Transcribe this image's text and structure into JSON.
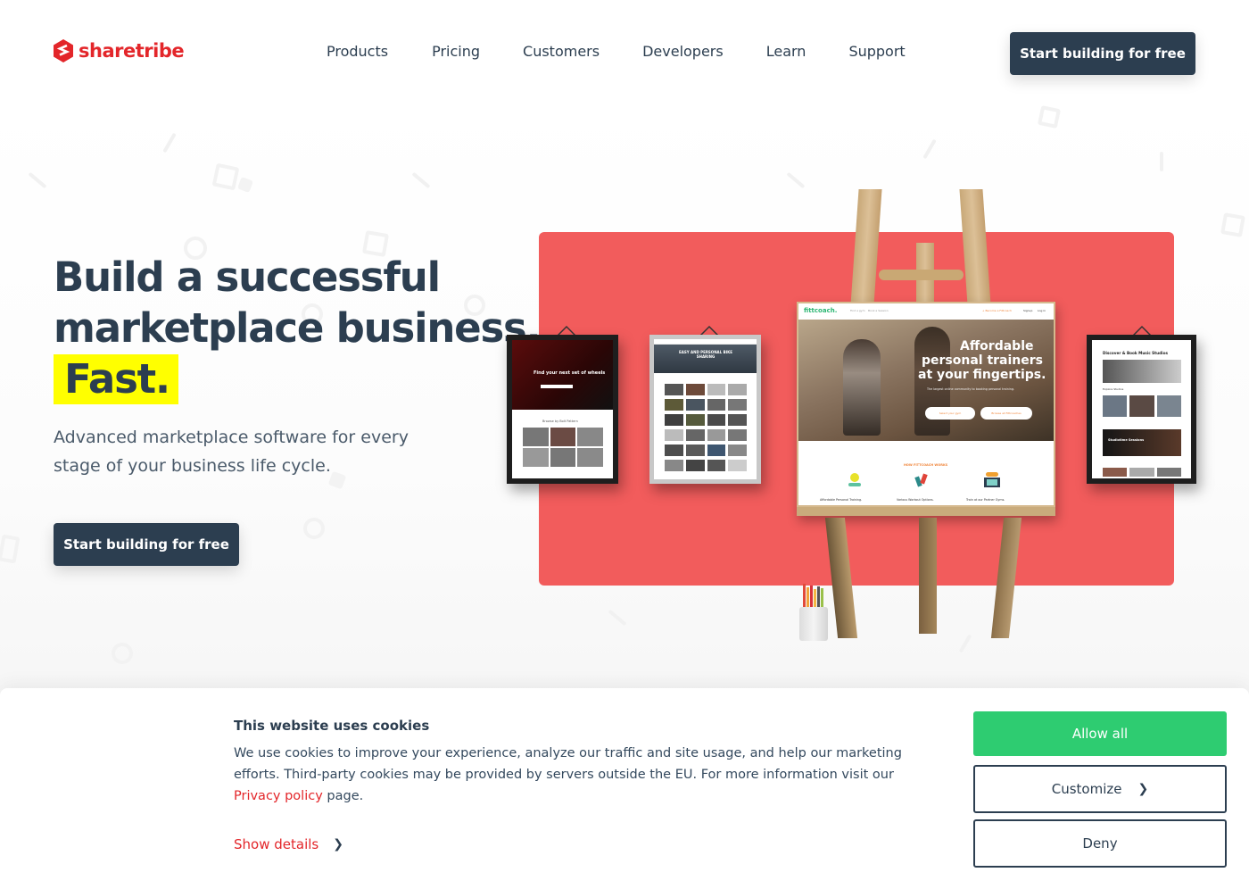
{
  "header": {
    "logo_text": "sharetribe",
    "nav": [
      {
        "label": "Products"
      },
      {
        "label": "Pricing"
      },
      {
        "label": "Customers"
      },
      {
        "label": "Developers"
      },
      {
        "label": "Learn"
      },
      {
        "label": "Support"
      }
    ],
    "cta_label": "Start building for free"
  },
  "hero": {
    "title_line1": "Build a successful",
    "title_line2": "marketplace business.",
    "title_highlight": "Fast.",
    "subtitle": "Advanced marketplace software for every stage of your business life cycle.",
    "cta_label": "Start building for free"
  },
  "illustration": {
    "frame_left": {
      "headline": "Find your next set of wheels",
      "section": "Browse by Bolt Pattern"
    },
    "frame_mid": {
      "headline": "EASY AND PERSONAL BIKE SHARING"
    },
    "frame_right": {
      "headline": "Discover & Book Music Studios",
      "section": "Explore Studios",
      "feature": "Studiotime Sessions"
    },
    "center_site": {
      "brand": "fittcoach.",
      "nav": [
        "Find a gym",
        "Book a Session"
      ],
      "top_links": [
        "+ Become a Fittcoach",
        "Signup",
        "Log in"
      ],
      "headline_1": "Affordable",
      "headline_2": "personal trainers",
      "headline_3": "at your fingertips.",
      "tagline": "The largest online community to booking personal training.",
      "button_1": "Select your gym",
      "button_2": "Browse all Fittcoaches",
      "section_title": "HOW FITTCOACH WORKS",
      "features": [
        "Affordable Personal Training.",
        "Various Workout Options.",
        "Train at our Partner Gyms."
      ]
    }
  },
  "cookie": {
    "title": "This website uses cookies",
    "body": "We use cookies to improve your experience, analyze our traffic and site usage, and help our marketing efforts. Third-party cookies may be provided by servers outside the EU. For more information visit our",
    "privacy_link": "Privacy policy",
    "body_end": " page.",
    "show_details": "Show details",
    "allow_all": "Allow all",
    "customize": "Customize",
    "deny": "Deny"
  },
  "colors": {
    "brand_red": "#e3262a",
    "dark_navy": "#2c3e50",
    "highlight_yellow": "#ffff00",
    "panel_coral": "#f25c5c",
    "allow_green": "#2ecc71"
  }
}
